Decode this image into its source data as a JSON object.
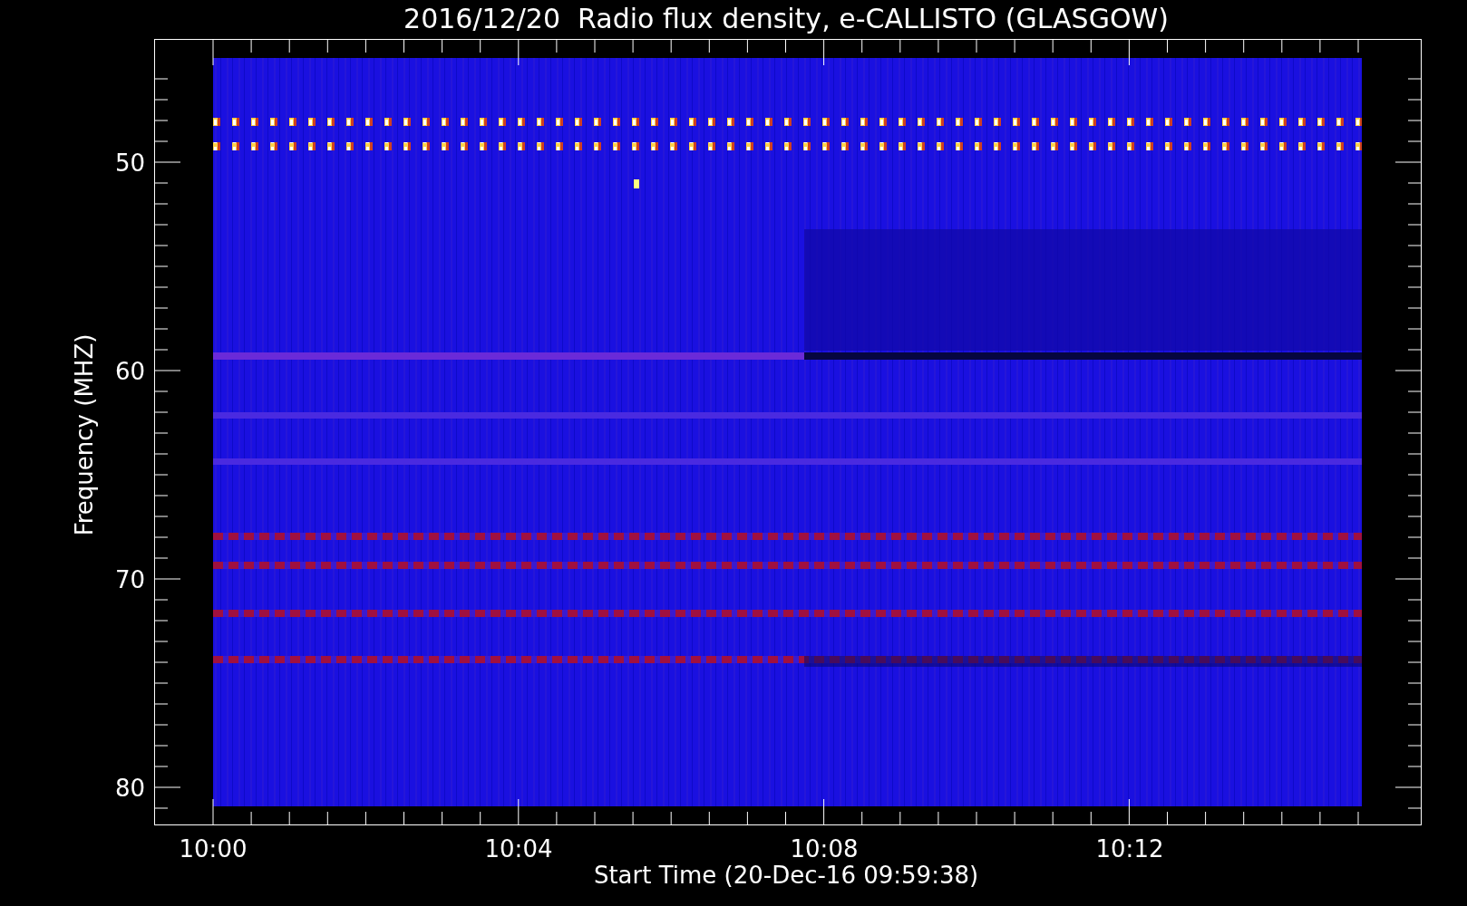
{
  "title": "2016/12/20  Radio flux density, e-CALLISTO (GLASGOW)",
  "plot": {
    "ylabel": "Frequency (MHZ)",
    "xlabel": "Start Time (20-Dec-16 09:59:38)",
    "yticks": [
      "50",
      "60",
      "70",
      "80"
    ],
    "xticks": [
      "10:00",
      "10:04",
      "10:08",
      "10:12"
    ]
  }
}
